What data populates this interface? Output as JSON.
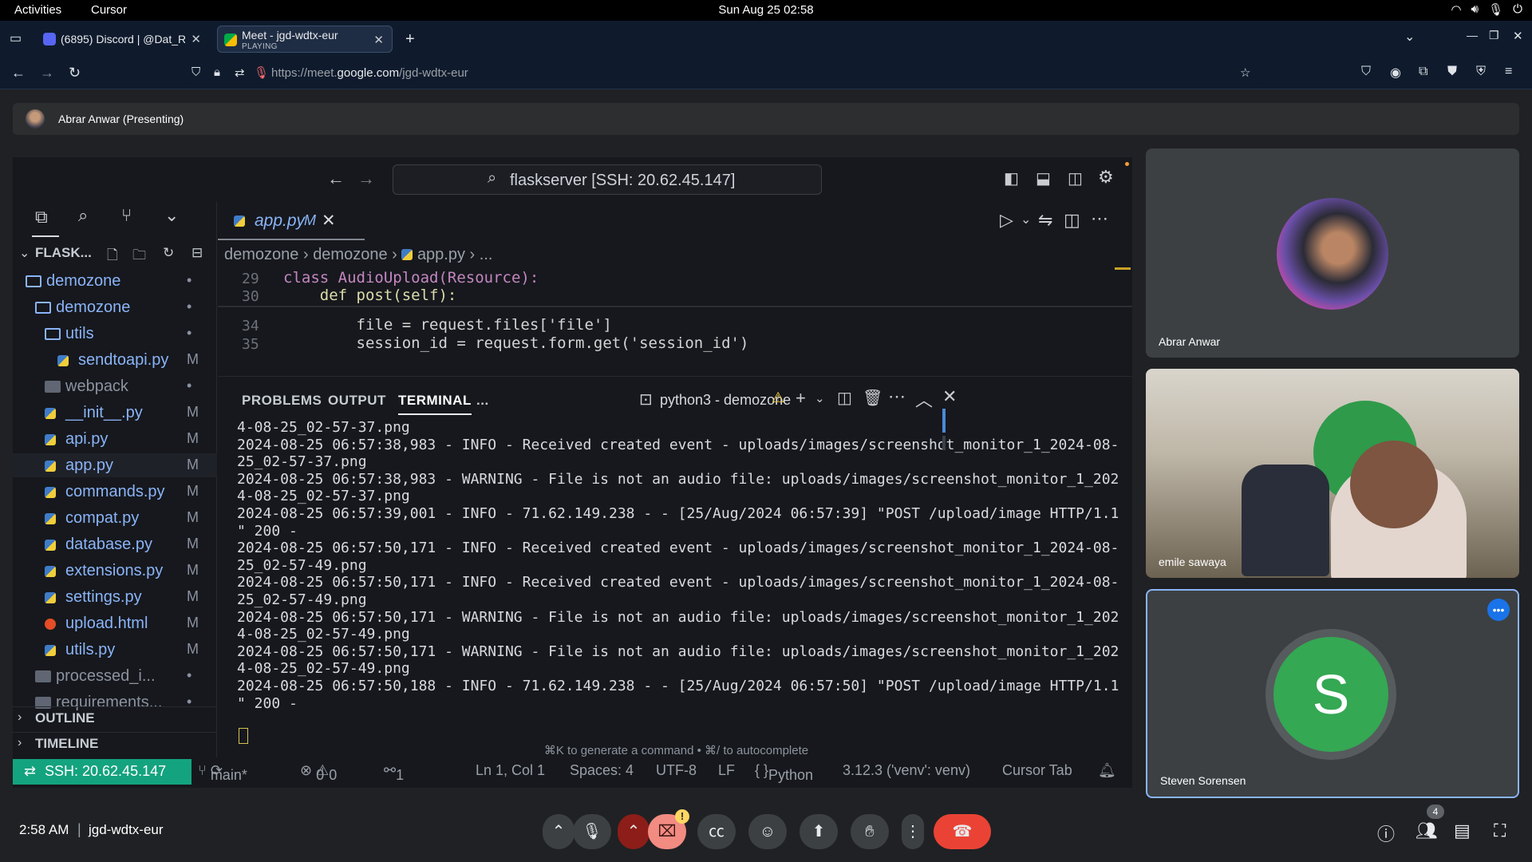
{
  "system_bar": {
    "activities": "Activities",
    "app_name": "Cursor",
    "datetime": "Sun Aug 25  02:58"
  },
  "browser": {
    "tabs": [
      {
        "title": "(6895) Discord | @Dat_R",
        "active": false
      },
      {
        "title": "Meet - jgd-wdtx-eur",
        "subtitle": "PLAYING",
        "active": true
      }
    ],
    "url_prefix": "https://meet.",
    "url_domain": "google.com",
    "url_path": "/jgd-wdtx-eur"
  },
  "meet": {
    "presenter_label": "Abrar Anwar (Presenting)",
    "time": "2:58 AM",
    "meeting_code": "jgd-wdtx-eur",
    "participant_count": "4",
    "participants": [
      {
        "name": "Abrar Anwar"
      },
      {
        "name": "emile sawaya"
      },
      {
        "name": "Steven Sorensen",
        "initial": "S"
      }
    ],
    "colors": {
      "avatar_green": "#34a853",
      "hangup_red": "#ea4335",
      "active_border": "#8ab4f8"
    }
  },
  "ide": {
    "command_center": "flaskserver [SSH: 20.62.45.147]",
    "tab_file": "app.py",
    "tab_modified": "M",
    "explorer_title": "FLASK...",
    "breadcrumb": [
      "demozone",
      "demozone",
      "app.py",
      "..."
    ],
    "tree": [
      {
        "name": "demozone",
        "kind": "folder",
        "status": "•"
      },
      {
        "name": "demozone",
        "kind": "folder",
        "status": "•"
      },
      {
        "name": "utils",
        "kind": "folder",
        "status": "•"
      },
      {
        "name": "sendtoapi.py",
        "kind": "py",
        "status": "M"
      },
      {
        "name": "webpack",
        "kind": "folder-solid",
        "status": "•"
      },
      {
        "name": "__init__.py",
        "kind": "py",
        "status": "M"
      },
      {
        "name": "api.py",
        "kind": "py",
        "status": "M"
      },
      {
        "name": "app.py",
        "kind": "py",
        "status": "M"
      },
      {
        "name": "commands.py",
        "kind": "py",
        "status": "M"
      },
      {
        "name": "compat.py",
        "kind": "py",
        "status": "M"
      },
      {
        "name": "database.py",
        "kind": "py",
        "status": "M"
      },
      {
        "name": "extensions.py",
        "kind": "py",
        "status": "M"
      },
      {
        "name": "settings.py",
        "kind": "py",
        "status": "M"
      },
      {
        "name": "upload.html",
        "kind": "html",
        "status": "M"
      },
      {
        "name": "utils.py",
        "kind": "py",
        "status": "M"
      },
      {
        "name": "processed_i...",
        "kind": "folder-solid",
        "status": "•"
      },
      {
        "name": "requirements...",
        "kind": "folder-solid",
        "status": "•"
      }
    ],
    "outline": "OUTLINE",
    "timeline": "TIMELINE",
    "code": [
      {
        "ln": "29",
        "text": "class AudioUpload(Resource):"
      },
      {
        "ln": "30",
        "text": "    def post(self):"
      },
      {
        "ln": "34",
        "text": "        file = request.files['file']"
      },
      {
        "ln": "35",
        "text": "        session_id = request.form.get('session_id')"
      }
    ],
    "panel_tabs": [
      "PROBLEMS",
      "OUTPUT",
      "TERMINAL",
      "..."
    ],
    "terminal_name": "python3 - demozone",
    "terminal_lines": [
      "4-08-25_02-57-37.png",
      "2024-08-25 06:57:38,983 - INFO - Received created event - uploads/images/screenshot_monitor_1_2024-08-",
      "25_02-57-37.png",
      "2024-08-25 06:57:38,983 - WARNING - File is not an audio file: uploads/images/screenshot_monitor_1_202",
      "4-08-25_02-57-37.png",
      "2024-08-25 06:57:39,001 - INFO - 71.62.149.238 - - [25/Aug/2024 06:57:39] \"POST /upload/image HTTP/1.1",
      "\" 200 -",
      "2024-08-25 06:57:50,171 - INFO - Received created event - uploads/images/screenshot_monitor_1_2024-08-",
      "25_02-57-49.png",
      "2024-08-25 06:57:50,171 - INFO - Received created event - uploads/images/screenshot_monitor_1_2024-08-",
      "25_02-57-49.png",
      "2024-08-25 06:57:50,171 - WARNING - File is not an audio file: uploads/images/screenshot_monitor_1_202",
      "4-08-25_02-57-49.png",
      "2024-08-25 06:57:50,171 - WARNING - File is not an audio file: uploads/images/screenshot_monitor_1_202",
      "4-08-25_02-57-49.png",
      "2024-08-25 06:57:50,188 - INFO - 71.62.149.238 - - [25/Aug/2024 06:57:50] \"POST /upload/image HTTP/1.1",
      "\" 200 -"
    ],
    "terminal_hint": "⌘K to generate a command • ⌘/ to autocomplete",
    "status": {
      "ssh": "SSH: 20.62.45.147",
      "branch": "main*",
      "errors": "0",
      "warnings": "0",
      "ports": "1",
      "position": "Ln 1, Col 1",
      "spaces": "Spaces: 4",
      "encoding": "UTF-8",
      "eol": "LF",
      "language": "Python",
      "interpreter": "3.12.3 ('venv': venv)",
      "cursor_tab": "Cursor Tab"
    }
  }
}
